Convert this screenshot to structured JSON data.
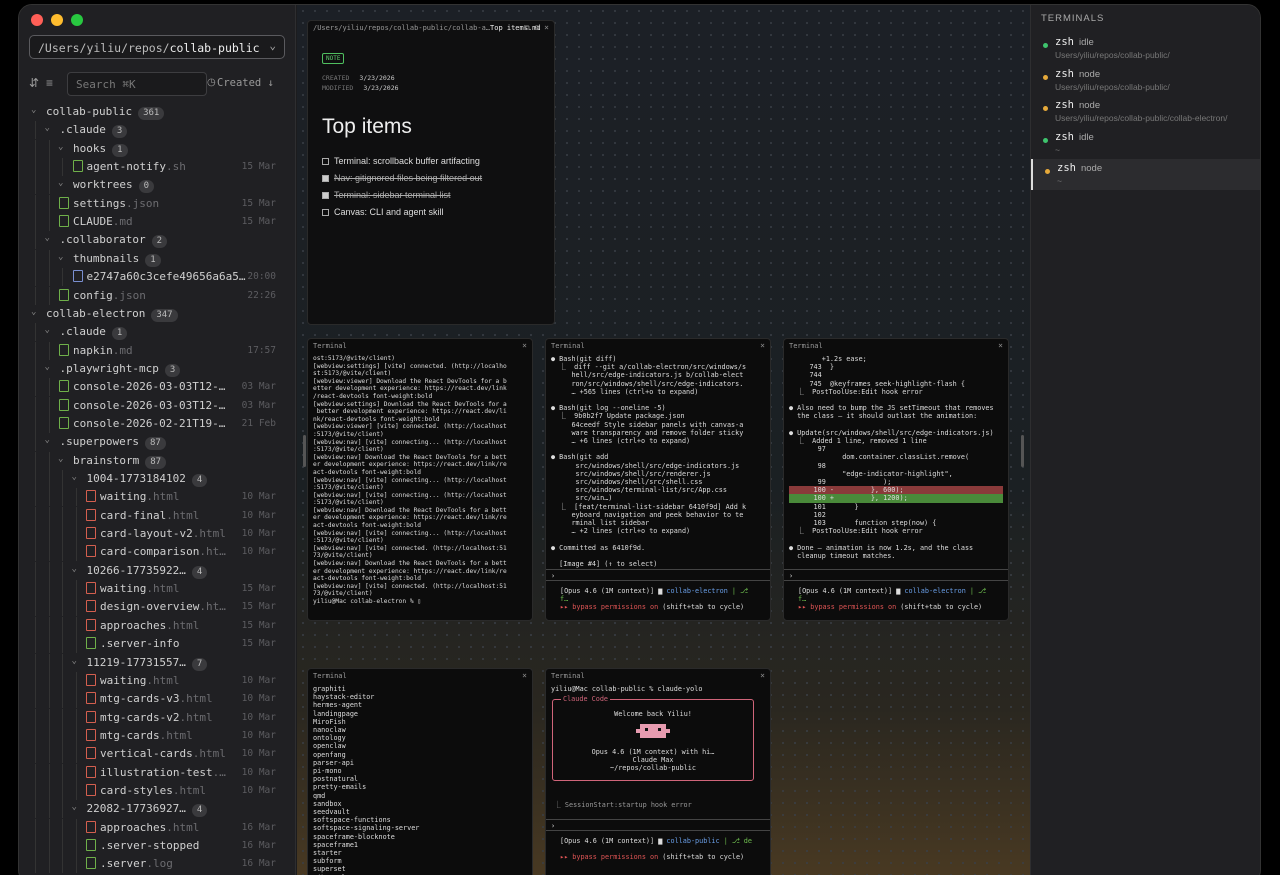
{
  "sidebar": {
    "path_prefix": "/Users/yiliu/repos/",
    "path_repo": "collab-public",
    "search_placeholder": "Search  ⌘K",
    "sort_label": "Created ↓",
    "tree": [
      {
        "d": 0,
        "t": "dir",
        "n": "collab-public",
        "b": "361"
      },
      {
        "d": 1,
        "t": "dir",
        "n": ".claude",
        "b": "3"
      },
      {
        "d": 2,
        "t": "dir",
        "n": "hooks",
        "b": "1"
      },
      {
        "d": 3,
        "t": "file",
        "n": "agent-notify",
        "e": ".sh",
        "dt": "15 Mar"
      },
      {
        "d": 2,
        "t": "dir",
        "n": "worktrees",
        "b": "0"
      },
      {
        "d": 2,
        "t": "file",
        "n": "settings",
        "e": ".json",
        "dt": "15 Mar"
      },
      {
        "d": 2,
        "t": "file",
        "n": "CLAUDE",
        "e": ".md",
        "dt": "15 Mar"
      },
      {
        "d": 1,
        "t": "dir",
        "n": ".collaborator",
        "b": "2"
      },
      {
        "d": 2,
        "t": "dir",
        "n": "thumbnails",
        "b": "1"
      },
      {
        "d": 3,
        "t": "img",
        "n": "e2747a60c3cefe49656a6a5…",
        "dt": "20:00"
      },
      {
        "d": 2,
        "t": "file",
        "n": "config",
        "e": ".json",
        "dt": "22:26"
      },
      {
        "d": 0,
        "t": "dir",
        "n": "collab-electron",
        "b": "347"
      },
      {
        "d": 1,
        "t": "dir",
        "n": ".claude",
        "b": "1"
      },
      {
        "d": 2,
        "t": "file",
        "n": "napkin",
        "e": ".md",
        "dt": "17:57"
      },
      {
        "d": 1,
        "t": "dir",
        "n": ".playwright-mcp",
        "b": "3"
      },
      {
        "d": 2,
        "t": "file",
        "n": "console-2026-03-03T12-…",
        "dt": "03 Mar"
      },
      {
        "d": 2,
        "t": "file",
        "n": "console-2026-03-03T12-…",
        "dt": "03 Mar"
      },
      {
        "d": 2,
        "t": "file",
        "n": "console-2026-02-21T19-…",
        "dt": "21 Feb"
      },
      {
        "d": 1,
        "t": "dir",
        "n": ".superpowers",
        "b": "87"
      },
      {
        "d": 2,
        "t": "dir",
        "n": "brainstorm",
        "b": "87"
      },
      {
        "d": 3,
        "t": "dir",
        "n": "1004-1773184102",
        "b": "4"
      },
      {
        "d": 4,
        "t": "html",
        "n": "waiting",
        "e": ".html",
        "dt": "10 Mar"
      },
      {
        "d": 4,
        "t": "html",
        "n": "card-final",
        "e": ".html",
        "dt": "10 Mar"
      },
      {
        "d": 4,
        "t": "html",
        "n": "card-layout-v2",
        "e": ".html",
        "dt": "10 Mar"
      },
      {
        "d": 4,
        "t": "html",
        "n": "card-comparison",
        "e": ".ht…",
        "dt": "10 Mar"
      },
      {
        "d": 3,
        "t": "dir",
        "n": "10266-17735922…",
        "b": "4"
      },
      {
        "d": 4,
        "t": "html",
        "n": "waiting",
        "e": ".html",
        "dt": "15 Mar"
      },
      {
        "d": 4,
        "t": "html",
        "n": "design-overview",
        "e": ".ht…",
        "dt": "15 Mar"
      },
      {
        "d": 4,
        "t": "html",
        "n": "approaches",
        "e": ".html",
        "dt": "15 Mar"
      },
      {
        "d": 4,
        "t": "file",
        "n": ".server-info",
        "dt": "15 Mar"
      },
      {
        "d": 3,
        "t": "dir",
        "n": "11219-17731557…",
        "b": "7"
      },
      {
        "d": 4,
        "t": "html",
        "n": "waiting",
        "e": ".html",
        "dt": "10 Mar"
      },
      {
        "d": 4,
        "t": "html",
        "n": "mtg-cards-v3",
        "e": ".html",
        "dt": "10 Mar"
      },
      {
        "d": 4,
        "t": "html",
        "n": "mtg-cards-v2",
        "e": ".html",
        "dt": "10 Mar"
      },
      {
        "d": 4,
        "t": "html",
        "n": "mtg-cards",
        "e": ".html",
        "dt": "10 Mar"
      },
      {
        "d": 4,
        "t": "html",
        "n": "vertical-cards",
        "e": ".html",
        "dt": "10 Mar"
      },
      {
        "d": 4,
        "t": "html",
        "n": "illustration-test",
        "e": ".…",
        "dt": "10 Mar"
      },
      {
        "d": 4,
        "t": "html",
        "n": "card-styles",
        "e": ".html",
        "dt": "10 Mar"
      },
      {
        "d": 3,
        "t": "dir",
        "n": "22082-17736927…",
        "b": "4"
      },
      {
        "d": 4,
        "t": "html",
        "n": "approaches",
        "e": ".html",
        "dt": "16 Mar"
      },
      {
        "d": 4,
        "t": "file",
        "n": ".server-stopped",
        "dt": "16 Mar"
      },
      {
        "d": 4,
        "t": "file",
        "n": ".server",
        "e": ".log",
        "dt": "16 Mar"
      }
    ]
  },
  "note": {
    "header": "/Users/yiliu/repos/collab-public/collab-a…",
    "header_title": "Top items.md",
    "tag": "NOTE",
    "created_label": "CREATED",
    "created": "3/23/2026",
    "modified_label": "MODIFIED",
    "modified": "3/23/2026",
    "title": "Top items",
    "todos": [
      {
        "text": "Terminal: scrollback buffer artifacting",
        "done": false
      },
      {
        "text": "Nav: gitignored files being filtered out",
        "done": true
      },
      {
        "text": "Terminal: sidebar terminal list",
        "done": true
      },
      {
        "text": "Canvas: CLI and agent skill",
        "done": false
      }
    ]
  },
  "terminals": {
    "label": "Terminal",
    "t1": "ost:5173/@vite/client)\n[webview:settings] [vite] connected. (http://localho\nst:5173/@vite/client)\n[webview:viewer] Download the React DevTools for a b\netter development experience: https://react.dev/link\n/react-devtools font-weight:bold\n[webview:settings] Download the React DevTools for a\n better development experience: https://react.dev/li\nnk/react-devtools font-weight:bold\n[webview:viewer] [vite] connected. (http://localhost\n:5173/@vite/client)\n[webview:nav] [vite] connecting... (http://localhost\n:5173/@vite/client)\n[webview:nav] Download the React DevTools for a bett\ner development experience: https://react.dev/link/re\nact-devtools font-weight:bold\n[webview:nav] [vite] connecting... (http://localhost\n:5173/@vite/client)\n[webview:nav] [vite] connecting... (http://localhost\n:5173/@vite/client)\n[webview:nav] Download the React DevTools for a bett\ner development experience: https://react.dev/link/re\nact-devtools font-weight:bold\n[webview:nav] [vite] connecting... (http://localhost\n:5173/@vite/client)\n[webview:nav] [vite] connected. (http://localhost:51\n73/@vite/client)\n[webview:nav] Download the React DevTools for a bett\ner development experience: https://react.dev/link/re\nact-devtools font-weight:bold\n[webview:nav] [vite] connected. (http://localhost:51\n73/@vite/client)\nyiliu@Mac collab-electron % ▯",
    "t2": "● Bash(git diff)\n  ⎿  diff --git a/collab-electron/src/windows/s\n     hell/src/edge-indicators.js b/collab-elect\n     ron/src/windows/shell/src/edge-indicators.\n     … +565 lines (ctrl+o to expand)\n\n● Bash(git log --oneline -5)\n  ⎿  9b0b2f7 Update package.json\n     64ceedf Style sidebar panels with canvas-a\n     ware transparency and remove folder sticky\n     … +6 lines (ctrl+o to expand)\n\n● Bash(git add\n      src/windows/shell/src/edge-indicators.js\n      src/windows/shell/src/renderer.js\n      src/windows/shell/src/shell.css\n      src/windows/terminal-list/src/App.css\n      src/win…)\n  ⎿  [feat/terminal-list-sidebar 6410f9d] Add k\n     eyboard navigation and peek behavior to te\n     rminal list sidebar\n     … +2 lines (ctrl+o to expand)\n\n● Committed as 6410f9d.\n\n  [Image #4] (↑ to select)",
    "t3a": "        +1.2s ease;\n     743  }\n     744\n     745  @keyframes seek-highlight-flash {\n  ⎿  PostToolUse:Edit hook error\n\n● Also need to bump the JS setTimeout that removes\n  the class — it should outlast the animation:\n\n● Update(src/windows/shell/src/edge-indicators.js)\n  ⎿  Added 1 line, removed 1 line\n       97\n             dom.container.classList.remove(\n       98\n             \"edge-indicator-highlight\",\n       99              );",
    "t3r": "      100 -         }, 600);",
    "t3g": "      100 +         }, 1200);",
    "t3b": "      101       }\n      102\n      103       function step(now) {\n  ⎿  PostToolUse:Edit hook error\n\n● Done — animation is now 1.2s, and the class\n  cleanup timeout matches.",
    "status_model": "[Opus 4.6 (1M context)] ▆",
    "status_repo": "collab-electron",
    "status_branch": "| ⎇ f…",
    "status_repo2": "collab-public",
    "status_branch2": "| ⎇ de",
    "bypass": "▸▸ bypass permissions on",
    "bypass_hint": " (shift+tab to cycle)",
    "prompt": "›",
    "t4": "graphiti\nhaystack-editor\nhermes-agent\nlandingpage\nMiroFish\nnanoclaw\nontology\nopenclaw\nopenfang\nparser-api\npi-mono\npostnatural\npretty-emails\nqmd\nsandbox\nseedvault\nsoftspace-functions\nsoftspace-signaling-server\nspaceframe-blocknote\nspaceframe1\nstarter\nsubform\nsuperset\nvibevault",
    "t5_cmd": "yiliu@Mac collab-public % claude-yolo",
    "t5_box_title": "Claude Code",
    "t5_welcome": "Welcome back Yiliu!",
    "t5_model": "Opus 4.6 (1M context) with hi…",
    "t5_plan": "Claude Max",
    "t5_dir": "~/repos/collab-public",
    "t5_hook": "⎿  SessionStart:startup hook error"
  },
  "right": {
    "title": "TERMINALS",
    "items": [
      {
        "name": "zsh",
        "status": "idle",
        "path": "Users/yiliu/repos/collab-public/",
        "color": "#3ec46d"
      },
      {
        "name": "zsh",
        "status": "node",
        "path": "Users/yiliu/repos/collab-public/",
        "color": "#e6a93a"
      },
      {
        "name": "zsh",
        "status": "node",
        "path": "Users/yiliu/repos/collab-public/collab-electron/",
        "color": "#e6a93a"
      },
      {
        "name": "zsh",
        "status": "idle",
        "path": "~",
        "color": "#3ec46d"
      },
      {
        "name": "zsh",
        "status": "node",
        "path": "~",
        "color": "#e6a93a"
      }
    ]
  }
}
